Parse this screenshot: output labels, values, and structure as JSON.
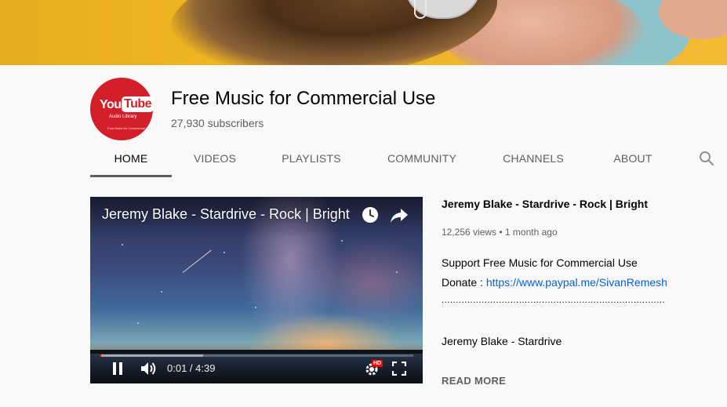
{
  "channel": {
    "name": "Free Music for Commercial Use",
    "subscribers": "27,930 subscribers",
    "avatar_text": {
      "you": "You",
      "tube": "Tube",
      "sub": "Audio Library",
      "tiny": "Free Music for Commercial Use"
    }
  },
  "tabs": [
    {
      "label": "HOME",
      "active": true
    },
    {
      "label": "VIDEOS",
      "active": false
    },
    {
      "label": "PLAYLISTS",
      "active": false
    },
    {
      "label": "COMMUNITY",
      "active": false
    },
    {
      "label": "CHANNELS",
      "active": false
    },
    {
      "label": "ABOUT",
      "active": false
    }
  ],
  "search": {
    "icon": "search-icon"
  },
  "player": {
    "title": "Jeremy Blake - Stardrive - Rock | Bright",
    "time": "0:01 / 4:39",
    "progress_fraction": 0.004,
    "buffered_fraction": 0.33,
    "hd_label": "HD",
    "icons": [
      "clock-icon",
      "share-icon",
      "pause-icon",
      "volume-icon",
      "settings-icon",
      "fullscreen-icon"
    ]
  },
  "video": {
    "title": "Jeremy Blake - Stardrive - Rock | Bright",
    "meta": "12,256 views • 1 month ago",
    "description": {
      "line1": "Support Free Music for Commercial Use",
      "donate_label": "Donate : ",
      "donate_link": "https://www.paypal.me/SivanRemesh",
      "dots": "..............................................................................",
      "line3": "Jeremy Blake - Stardrive"
    },
    "read_more": "READ MORE"
  },
  "colors": {
    "youtube_red": "#d31f2a",
    "link_blue": "#065fd4",
    "progress_red": "#ff0000",
    "page_bg": "#f9f9f9"
  }
}
